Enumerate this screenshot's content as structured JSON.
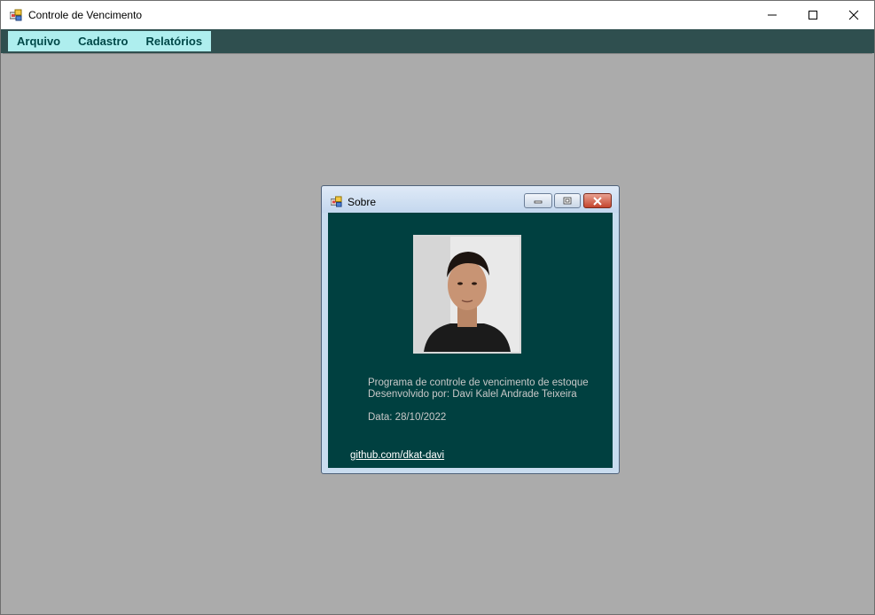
{
  "window": {
    "title": "Controle de Vencimento",
    "controls": {
      "minimize": "—",
      "maximize": "☐",
      "close": "✕"
    }
  },
  "menu": {
    "items": [
      "Arquivo",
      "Cadastro",
      "Relatórios"
    ]
  },
  "dialog": {
    "title": "Sobre",
    "description_line1": "Programa de controle de vencimento de estoque",
    "description_line2": "Desenvolvido por: Davi Kalel Andrade Teixeira",
    "date": "Data: 28/10/2022",
    "link": "github.com/dkat-davi",
    "photo_icon": "profile-photo"
  },
  "colors": {
    "menubar": "#2f4f4f",
    "menu_strip": "#aeeeee",
    "menu_text": "#004848",
    "dialog_client": "#004040",
    "mdi_background": "#ababab"
  }
}
